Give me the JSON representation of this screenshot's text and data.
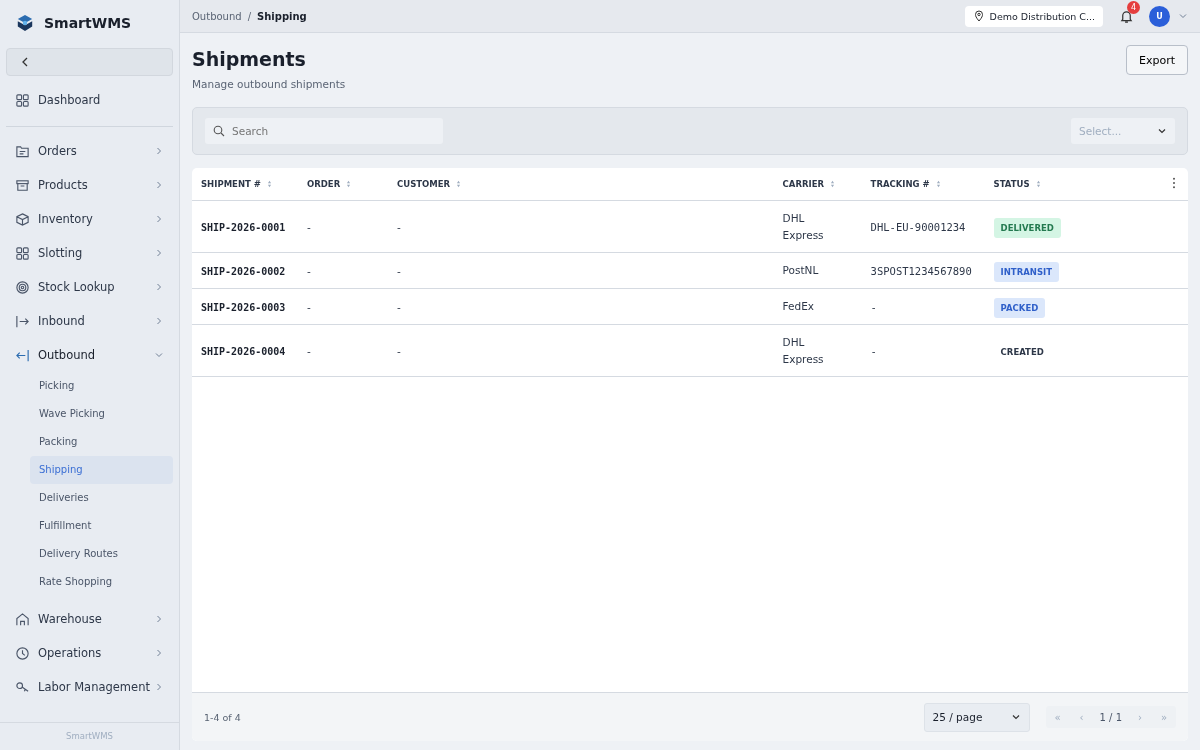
{
  "app": {
    "name": "SmartWMS",
    "footer": "SmartWMS"
  },
  "sidebar": {
    "items": [
      {
        "label": "Dashboard",
        "selected": false
      },
      {
        "label": "Orders",
        "selected": false,
        "expanded": false
      },
      {
        "label": "Products",
        "selected": false,
        "expanded": false
      },
      {
        "label": "Inventory",
        "selected": false,
        "expanded": false
      },
      {
        "label": "Slotting",
        "selected": false,
        "expanded": false
      },
      {
        "label": "Stock Lookup",
        "selected": false,
        "expanded": false
      },
      {
        "label": "Inbound",
        "selected": false,
        "expanded": false
      },
      {
        "label": "Outbound",
        "selected": true,
        "expanded": true,
        "children": [
          {
            "label": "Picking",
            "selected": false
          },
          {
            "label": "Wave Picking",
            "selected": false
          },
          {
            "label": "Packing",
            "selected": false
          },
          {
            "label": "Shipping",
            "selected": true
          },
          {
            "label": "Deliveries",
            "selected": false
          },
          {
            "label": "Fulfillment",
            "selected": false
          },
          {
            "label": "Delivery Routes",
            "selected": false
          },
          {
            "label": "Rate Shopping",
            "selected": false
          }
        ]
      },
      {
        "label": "Warehouse",
        "selected": false,
        "expanded": false
      },
      {
        "label": "Operations",
        "selected": false,
        "expanded": false
      },
      {
        "label": "Labor Management",
        "selected": false,
        "expanded": false
      }
    ]
  },
  "breadcrumb": {
    "items": [
      "Outbound",
      "Shipping"
    ],
    "separator": "/"
  },
  "topbar": {
    "site": "Demo Distribution C...",
    "notifications": "4",
    "avatar": "U"
  },
  "page": {
    "title": "Shipments",
    "subtitle": "Manage outbound shipments",
    "export": "Export"
  },
  "filters": {
    "search": {
      "placeholder": "Search"
    },
    "select": {
      "placeholder": "Select..."
    }
  },
  "table": {
    "columns": [
      "SHIPMENT #",
      "ORDER",
      "CUSTOMER",
      "CARRIER",
      "TRACKING #",
      "STATUS"
    ],
    "rows": [
      {
        "shipment": "SHIP-2026-0001",
        "order": "-",
        "customer": "-",
        "carrier": "DHL Express",
        "tracking": "DHL-EU-90001234",
        "status": {
          "label": "DELIVERED",
          "kind": "success"
        }
      },
      {
        "shipment": "SHIP-2026-0002",
        "order": "-",
        "customer": "-",
        "carrier": "PostNL",
        "tracking": "3SPOST1234567890",
        "status": {
          "label": "INTRANSIT",
          "kind": "info"
        }
      },
      {
        "shipment": "SHIP-2026-0003",
        "order": "-",
        "customer": "-",
        "carrier": "FedEx",
        "tracking": "-",
        "status": {
          "label": "PACKED",
          "kind": "info"
        }
      },
      {
        "shipment": "SHIP-2026-0004",
        "order": "-",
        "customer": "-",
        "carrier": "DHL Express",
        "tracking": "-",
        "status": {
          "label": "CREATED",
          "kind": "plain"
        }
      }
    ]
  },
  "pagination": {
    "summary": "1-4 of 4",
    "page_size": "25 / page",
    "first": "«",
    "prev": "‹",
    "page": "1 / 1",
    "next": "›",
    "last": "»"
  }
}
